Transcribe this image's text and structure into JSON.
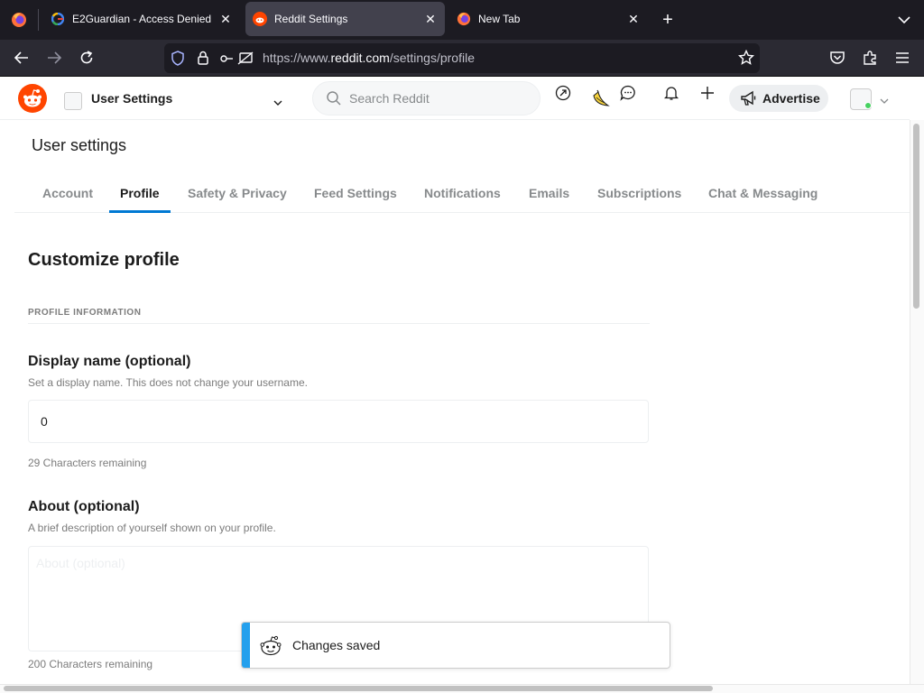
{
  "browser": {
    "tabs": [
      {
        "title": "E2Guardian - Access Denied",
        "active": false,
        "favicon": "google-icon"
      },
      {
        "title": "Reddit Settings",
        "active": true,
        "favicon": "reddit-icon"
      },
      {
        "title": "New Tab",
        "active": false,
        "favicon": "firefox-icon"
      }
    ],
    "url_prefix": "https://www.",
    "url_domain": "reddit.com",
    "url_path": "/settings/profile"
  },
  "header": {
    "community_label": "User Settings",
    "search_placeholder": "Search Reddit",
    "advertise_label": "Advertise"
  },
  "settings": {
    "page_title": "User settings",
    "tabs": [
      {
        "label": "Account",
        "active": false
      },
      {
        "label": "Profile",
        "active": true
      },
      {
        "label": "Safety & Privacy",
        "active": false
      },
      {
        "label": "Feed Settings",
        "active": false
      },
      {
        "label": "Notifications",
        "active": false
      },
      {
        "label": "Emails",
        "active": false
      },
      {
        "label": "Subscriptions",
        "active": false
      },
      {
        "label": "Chat & Messaging",
        "active": false
      }
    ],
    "section_title": "Customize profile",
    "section_label": "PROFILE INFORMATION",
    "display_name": {
      "title": "Display name (optional)",
      "description": "Set a display name. This does not change your username.",
      "value": "0",
      "remaining": "29 Characters remaining"
    },
    "about": {
      "title": "About (optional)",
      "description": "A brief description of yourself shown on your profile.",
      "placeholder": "About (optional)",
      "remaining": "200 Characters remaining"
    }
  },
  "toast": {
    "message": "Changes saved"
  },
  "colors": {
    "accent_blue": "#0079d3",
    "toast_accent": "#24a0ed",
    "reddit_orange": "#ff4500",
    "online_green": "#46d160"
  }
}
